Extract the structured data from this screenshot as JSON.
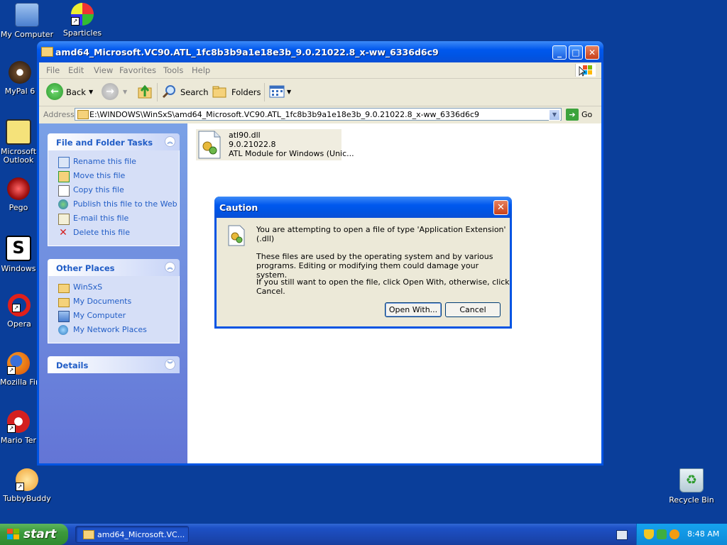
{
  "desktop": {
    "icons": [
      {
        "label": "My Computer",
        "icon": "my-computer-icon"
      },
      {
        "label": "Sparticles",
        "icon": "sparticles-icon"
      },
      {
        "label": "MyPal 6",
        "icon": "mypal-icon"
      },
      {
        "label": "Microsoft Outlook",
        "icon": "outlook-icon"
      },
      {
        "label": "Pego",
        "icon": "pego-icon"
      },
      {
        "label": "Windows",
        "icon": "windows-icon"
      },
      {
        "label": "Opera",
        "icon": "opera-icon"
      },
      {
        "label": "Mozilla Fir",
        "icon": "firefox-icon"
      },
      {
        "label": "Mario Ter",
        "icon": "mario-icon"
      },
      {
        "label": "TubbyBuddy",
        "icon": "tubbybuddy-icon"
      },
      {
        "label": "Recycle Bin",
        "icon": "recycle-bin-icon"
      }
    ]
  },
  "explorer": {
    "title": "amd64_Microsoft.VC90.ATL_1fc8b3b9a1e18e3b_9.0.21022.8_x-ww_6336d6c9",
    "menu": [
      "File",
      "Edit",
      "View",
      "Favorites",
      "Tools",
      "Help"
    ],
    "toolbar": {
      "back": "Back",
      "search": "Search",
      "folders": "Folders"
    },
    "address": {
      "label": "Address",
      "path": "E:\\WINDOWS\\WinSxS\\amd64_Microsoft.VC90.ATL_1fc8b3b9a1e18e3b_9.0.21022.8_x-ww_6336d6c9",
      "go": "Go"
    },
    "file_tasks": {
      "title": "File and Folder Tasks",
      "items": [
        "Rename this file",
        "Move this file",
        "Copy this file",
        "Publish this file to the Web",
        "E-mail this file",
        "Delete this file"
      ]
    },
    "other_places": {
      "title": "Other Places",
      "items": [
        "WinSxS",
        "My Documents",
        "My Computer",
        "My Network Places"
      ]
    },
    "details": {
      "title": "Details"
    },
    "file": {
      "name": "atl90.dll",
      "version": "9.0.21022.8",
      "description": "ATL Module for Windows (Unic..."
    }
  },
  "dialog": {
    "title": "Caution",
    "line1": "You are attempting to open a file of type 'Application Extension' (.dll)",
    "para2_l1": "These files are used by the operating system and by various",
    "para2_l2": "programs. Editing or modifying them could damage your system.",
    "para3_l1": "If you still want to open the file, click Open With, otherwise, click",
    "para3_l2": "Cancel.",
    "open_with": "Open With...",
    "cancel": "Cancel"
  },
  "taskbar": {
    "start": "start",
    "task_button": "amd64_Microsoft.VC...",
    "clock": "8:48 AM"
  },
  "colors": {
    "desktop": "#0a3e9a",
    "titlebar": "#0054e3",
    "taskpane_link": "#215dc6",
    "start_green": "#3c9a3c"
  }
}
